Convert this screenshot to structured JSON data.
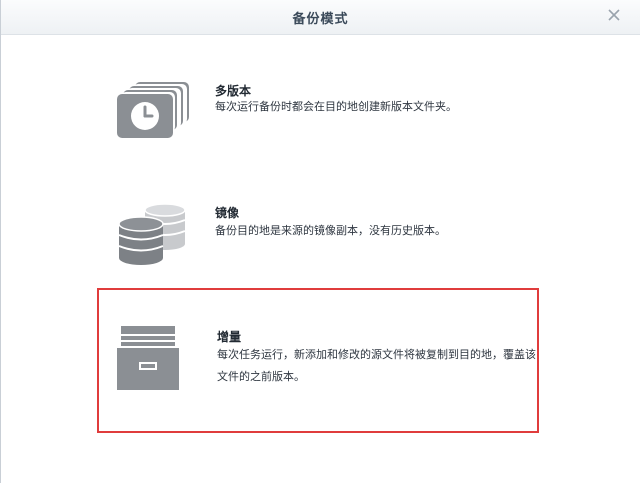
{
  "dialog": {
    "title": "备份模式",
    "close_icon": "close-icon"
  },
  "options": [
    {
      "id": "multi-version",
      "icon": "clock-stack-icon",
      "title": "多版本",
      "description": "每次运行备份时都会在目的地创建新版本文件夹。"
    },
    {
      "id": "mirror",
      "icon": "database-stack-icon",
      "title": "镜像",
      "description": "备份目的地是来源的镜像副本，没有历史版本。"
    },
    {
      "id": "incremental",
      "icon": "file-cabinet-icon",
      "title": "增量",
      "description": "每次任务运行，新添加和修改的源文件将被复制到目的地，覆盖该文件的之前版本。",
      "selected": true
    }
  ],
  "colors": {
    "icon_gray": "#8b8f94",
    "highlight_border": "#e03c3c",
    "title_text": "#3b4a5a"
  }
}
